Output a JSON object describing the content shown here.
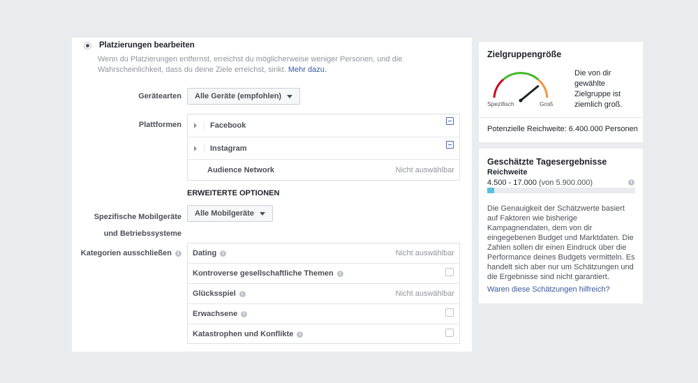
{
  "placement": {
    "label": "Platzierungen bearbeiten",
    "description": "Wenn du Platzierungen entfernst, erreichst du möglicherweise weniger Personen, und die Wahrscheinlichkeit, dass du deine Ziele erreichst, sinkt.",
    "link": "Mehr dazu."
  },
  "device_types": {
    "label": "Gerätearten",
    "value": "Alle Geräte (empfohlen)"
  },
  "platforms": {
    "label": "Plattformen",
    "items": [
      {
        "name": "Facebook"
      },
      {
        "name": "Instagram"
      },
      {
        "name": "Audience Network",
        "status": "Nicht auswählbar"
      }
    ]
  },
  "advanced": {
    "title": "ERWEITERTE OPTIONEN"
  },
  "mobile_devices": {
    "label_line1": "Spezifische Mobilgeräte",
    "label_line2": "und Betriebssysteme",
    "value": "Alle Mobilgeräte"
  },
  "exclude": {
    "label": "Kategorien ausschließen",
    "items": [
      {
        "name": "Dating",
        "status": "Nicht auswählbar"
      },
      {
        "name": "Kontroverse gesellschaftliche Themen"
      },
      {
        "name": "Glücksspiel",
        "status": "Nicht auswählbar"
      },
      {
        "name": "Erwachsene"
      },
      {
        "name": "Katastrophen und Konflikte"
      }
    ]
  },
  "audience_size": {
    "title": "Zielgruppengröße",
    "gauge_left": "Spezifisch",
    "gauge_right": "Groß",
    "gauge_level": 0.78,
    "text": "Die von dir gewählte Zielgruppe ist ziemlich groß.",
    "potential_reach": "Potenzielle Reichweite: 6.400.000 Personen"
  },
  "daily_results": {
    "title": "Geschätzte Tagesergebnisse",
    "metric": "Reichweite",
    "range": "4.500 - 17.000",
    "total": "(von 5.900.000)",
    "fill_fraction": 0.045,
    "disclaimer": "Die Genauigkeit der Schätzwerte basiert auf Faktoren wie bisherige Kampagnendaten, dem von dir eingegebenen Budget und Marktdaten. Die Zahlen sollen dir einen Eindruck über die Performance deines Budgets vermitteln. Es handelt sich aber nur um Schätzungen und die Ergebnisse sind nicht garantiert.",
    "feedback_link": "Waren diese Schätzungen hilfreich?"
  },
  "colors": {
    "link": "#365899",
    "bar_fill": "#5bc0de",
    "gauge_red": "#d0021b",
    "gauge_green": "#42b72a",
    "gauge_orange": "#f7923b"
  },
  "icons": {
    "info": "info-icon",
    "expand": "expand-triangle-icon",
    "collapse": "minus-square-icon"
  }
}
